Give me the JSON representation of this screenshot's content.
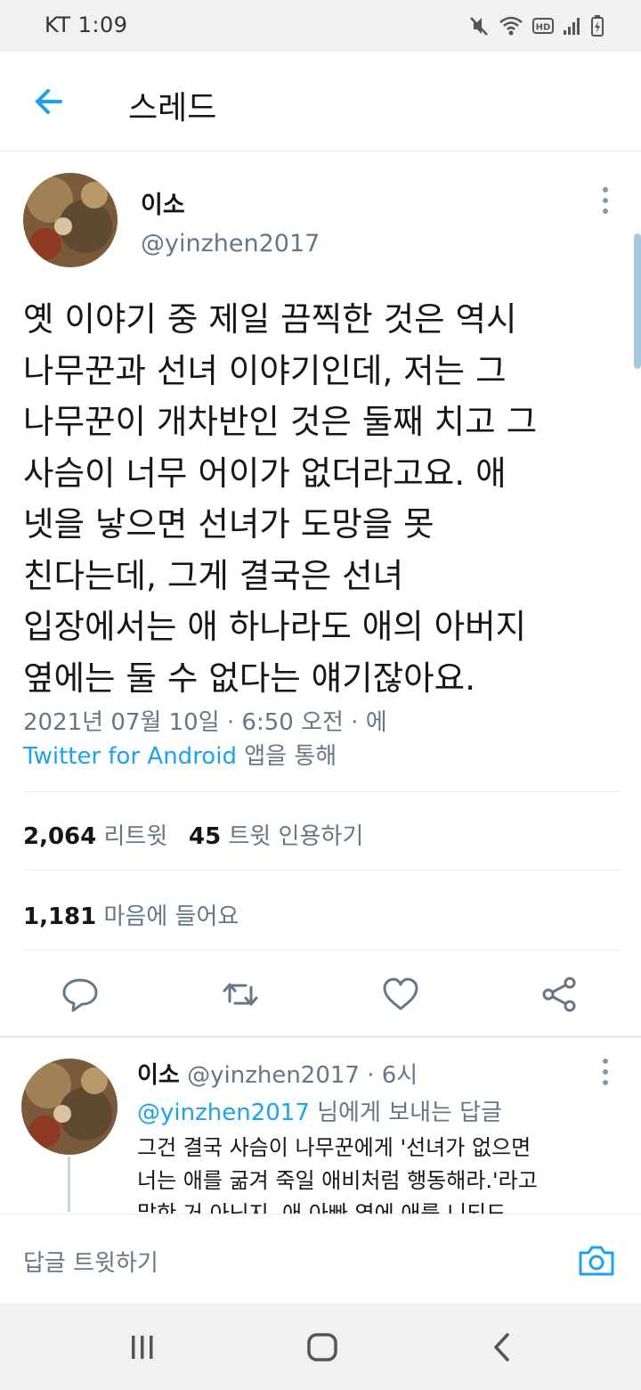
{
  "status_bar": {
    "carrier_time": "KT  1:09"
  },
  "header": {
    "title": "스레드"
  },
  "tweet": {
    "author_name": "이소",
    "author_handle": "@yinzhen2017",
    "lines": [
      "옛 이야기 중 제일 끔찍한 것은 역시",
      "나무꾼과 선녀 이야기인데, 저는 그",
      "나무꾼이 개차반인 것은 둘째 치고 그",
      "사슴이 너무 어이가 없더라고요. 애",
      "넷을 낳으면 선녀가 도망을 못",
      "친다는데, 그게 결국은 선녀",
      "입장에서는 애 하나라도 애의 아버지",
      "옆에는 둘 수 없다는 얘기잖아요."
    ],
    "date_line": "2021년 07월 10일 · 6:50 오전 · 에",
    "source_app": "Twitter for Android",
    "source_suffix": " 앱을 통해",
    "retweets_count": "2,064",
    "retweets_label": "리트윗",
    "quotes_count": "45",
    "quotes_label": "트윗 인용하기",
    "likes_count": "1,181",
    "likes_label": "마음에 들어요"
  },
  "reply": {
    "author_name": "이소",
    "author_handle": "@yinzhen2017",
    "time": " · 6시",
    "replying_to_mention": "@yinzhen2017",
    "replying_to_suffix": " 님에게 보내는 답글",
    "lines": [
      "그건 결국 사슴이 나무꾼에게 '선녀가 없으면",
      "너는 애를 굶겨 죽일 애비처럼 행동해라.'라고",
      "말한 거 아닌지. 애 아빠 옆에 애를 니되도"
    ]
  },
  "composer": {
    "placeholder": "답글 트윗하기"
  },
  "colors": {
    "accent": "#1da1f2",
    "secondary_text": "#657786",
    "primary_text": "#14171a",
    "divider": "#e6ecf0"
  },
  "icons": [
    "back-arrow-icon",
    "more-vert-icon",
    "reply-icon",
    "retweet-icon",
    "like-icon",
    "share-icon",
    "camera-icon",
    "recents-icon",
    "home-icon",
    "back-nav-icon"
  ]
}
